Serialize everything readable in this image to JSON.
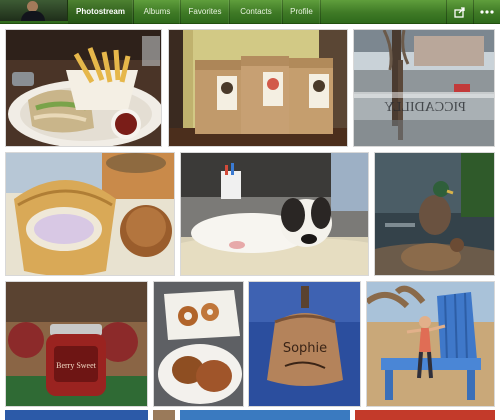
{
  "nav": {
    "tabs": [
      {
        "label": "Photostream",
        "active": true
      },
      {
        "label": "Albums",
        "active": false
      },
      {
        "label": "Favorites",
        "active": false
      },
      {
        "label": "Contacts",
        "active": false
      },
      {
        "label": "Profile",
        "active": false
      }
    ],
    "share_icon": "share-icon",
    "more_icon": "more-icon",
    "bar_color": "#3f7a26"
  },
  "photos": {
    "street_sign": "PICCADILLY",
    "jar_label": "Berry Sweet",
    "bell_text": "Sophie"
  }
}
